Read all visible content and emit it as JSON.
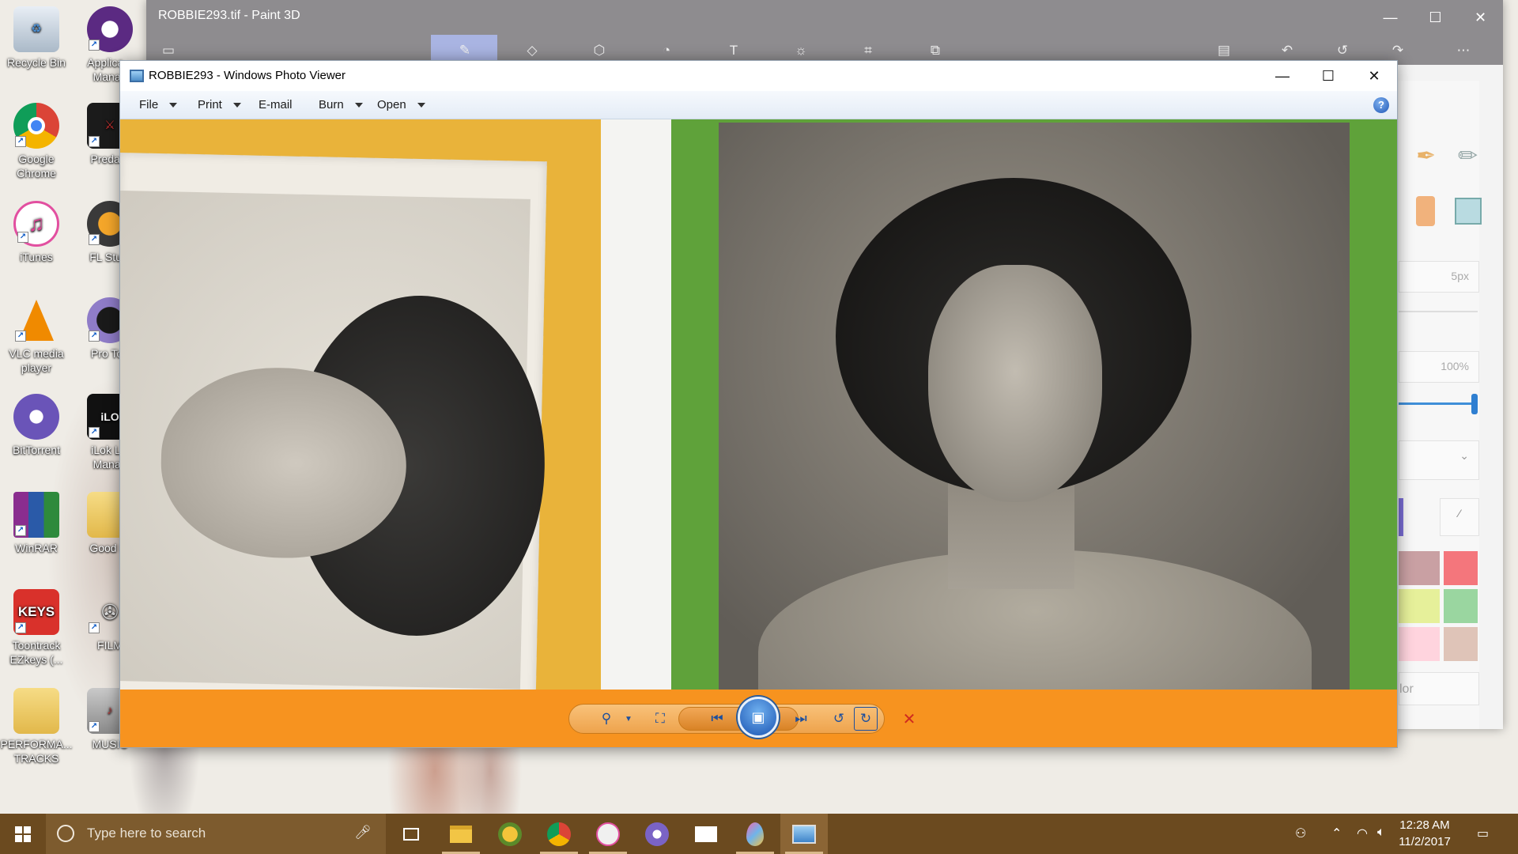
{
  "desktop": {
    "icons_col1": [
      {
        "label": "Recycle Bin",
        "icon": "recycle-bin-icon",
        "color": "#c9d6e2"
      },
      {
        "label": "Google Chrome",
        "icon": "chrome-icon",
        "color": "#db4437"
      },
      {
        "label": "iTunes",
        "icon": "itunes-icon",
        "color": "#ffffff"
      },
      {
        "label": "VLC media player",
        "icon": "vlc-icon",
        "color": "#f08a00"
      },
      {
        "label": "BitTorrent",
        "icon": "bittorrent-icon",
        "color": "#6a54b8"
      },
      {
        "label": "WinRAR",
        "icon": "winrar-icon",
        "color": "#8a2d8f"
      },
      {
        "label": "Toontrack EZkeys (...",
        "icon": "ezkeys-icon",
        "color": "#d9312b"
      },
      {
        "label": "PERFORMA... TRACKS",
        "icon": "folder-icon",
        "color": "#e8c35a"
      }
    ],
    "icons_col2": [
      {
        "label": "Applica... Manag",
        "icon": "app-manager-icon",
        "color": "#5b2a82"
      },
      {
        "label": "Predato",
        "icon": "predator-icon",
        "color": "#1b1b1b"
      },
      {
        "label": "FL Studi",
        "icon": "fl-studio-icon",
        "color": "#3a3a3a"
      },
      {
        "label": "Pro Too",
        "icon": "pro-tools-icon",
        "color": "#3b2a5a"
      },
      {
        "label": "iLok Lic Manag",
        "icon": "ilok-icon",
        "color": "#111111"
      },
      {
        "label": "Good Fr",
        "icon": "folder-icon",
        "color": "#e8c35a"
      },
      {
        "label": "FILM",
        "icon": "film-icon",
        "color": "#9aa0a8"
      },
      {
        "label": "MUSIC",
        "icon": "music-folder-icon",
        "color": "#b23a3a"
      }
    ]
  },
  "paint3d": {
    "title": "ROBBIE293.tif - Paint 3D",
    "thickness": "5px",
    "opacity": "100%",
    "color_label": "lor",
    "swatches": [
      "#c9a0a3",
      "#f4767c",
      "#e6f09a",
      "#9ad6a0",
      "#ffd4de",
      "#dfc4b8"
    ]
  },
  "viewer": {
    "title": "ROBBIE293 - Windows Photo Viewer",
    "menu": {
      "file": "File",
      "print": "Print",
      "email": "E-mail",
      "burn": "Burn",
      "open": "Open",
      "help": "?"
    },
    "accent": "#f7931f"
  },
  "taskbar": {
    "search_placeholder": "Type here to search",
    "time": "12:28 AM",
    "date": "11/2/2017",
    "apps": [
      {
        "name": "file-explorer",
        "color": "#f2c545"
      },
      {
        "name": "fl-studio",
        "color": "#f3c43a"
      },
      {
        "name": "chrome",
        "color": "#db4437"
      },
      {
        "name": "itunes",
        "color": "#f0f0f0"
      },
      {
        "name": "bittorrent",
        "color": "#7a63c6"
      },
      {
        "name": "mail",
        "color": "#ffffff"
      },
      {
        "name": "paint-3d",
        "color": "#f06ab0"
      },
      {
        "name": "photo-viewer",
        "color": "#6fb4ea"
      }
    ]
  }
}
